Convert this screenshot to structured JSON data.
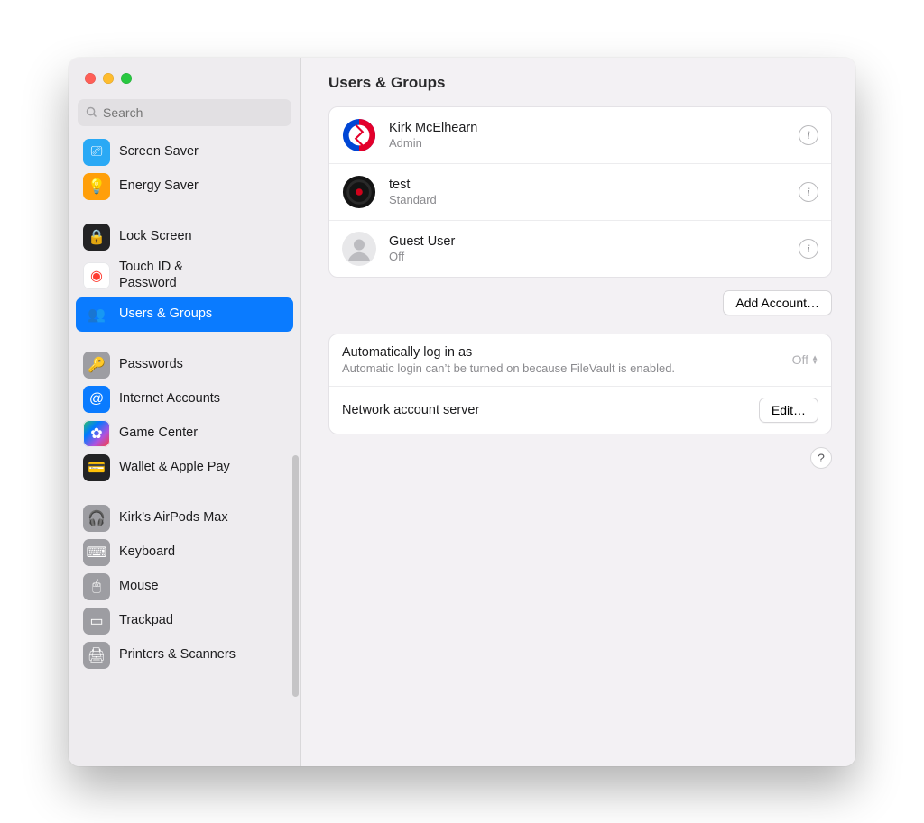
{
  "window": {
    "title": "Users & Groups",
    "search_placeholder": "Search"
  },
  "sidebar": {
    "groups": [
      {
        "items": [
          {
            "id": "screen-saver",
            "label": "Screen Saver",
            "icon_name": "screensaver-icon",
            "icon_bg": "#2aa9f5",
            "glyph": "⎚",
            "selected": false,
            "multiline": false
          },
          {
            "id": "energy-saver",
            "label": "Energy Saver",
            "icon_name": "bulb-icon",
            "icon_bg": "#ff9f0a",
            "glyph": "💡",
            "selected": false,
            "multiline": false
          }
        ]
      },
      {
        "items": [
          {
            "id": "lock-screen",
            "label": "Lock Screen",
            "icon_name": "lock-icon",
            "icon_bg": "#232325",
            "glyph": "🔒",
            "selected": false,
            "multiline": false
          },
          {
            "id": "touchid",
            "label": "Touch ID & Password",
            "icon_name": "touchid-icon",
            "icon_bg": "#ffffff",
            "glyph": "◉",
            "selected": false,
            "multiline": true
          },
          {
            "id": "users-groups",
            "label": "Users & Groups",
            "icon_name": "users-icon",
            "icon_bg": "#0a7bff",
            "glyph": "👥",
            "selected": true,
            "multiline": false
          }
        ]
      },
      {
        "items": [
          {
            "id": "passwords",
            "label": "Passwords",
            "icon_name": "key-icon",
            "icon_bg": "#9d9da2",
            "glyph": "🔑",
            "selected": false,
            "multiline": false
          },
          {
            "id": "internet-acc",
            "label": "Internet Accounts",
            "icon_name": "at-icon",
            "icon_bg": "#0a7bff",
            "glyph": "@",
            "selected": false,
            "multiline": false
          },
          {
            "id": "game-center",
            "label": "Game Center",
            "icon_name": "game-icon",
            "icon_bg": "#ffffff",
            "glyph": "✿",
            "selected": false,
            "multiline": false
          },
          {
            "id": "wallet",
            "label": "Wallet & Apple Pay",
            "icon_name": "wallet-icon",
            "icon_bg": "#232325",
            "glyph": "💳",
            "selected": false,
            "multiline": false
          }
        ]
      },
      {
        "items": [
          {
            "id": "airpods",
            "label": "Kirk’s AirPods Max",
            "icon_name": "headphones-icon",
            "icon_bg": "#9d9da2",
            "glyph": "🎧",
            "selected": false,
            "multiline": false
          },
          {
            "id": "keyboard",
            "label": "Keyboard",
            "icon_name": "keyboard-icon",
            "icon_bg": "#9d9da2",
            "glyph": "⌨",
            "selected": false,
            "multiline": false
          },
          {
            "id": "mouse",
            "label": "Mouse",
            "icon_name": "mouse-icon",
            "icon_bg": "#9d9da2",
            "glyph": "🖱",
            "selected": false,
            "multiline": false
          },
          {
            "id": "trackpad",
            "label": "Trackpad",
            "icon_name": "trackpad-icon",
            "icon_bg": "#9d9da2",
            "glyph": "▭",
            "selected": false,
            "multiline": false
          },
          {
            "id": "printers",
            "label": "Printers & Scanners",
            "icon_name": "printer-icon",
            "icon_bg": "#9d9da2",
            "glyph": "🖨",
            "selected": false,
            "multiline": false
          }
        ]
      }
    ]
  },
  "content": {
    "users": [
      {
        "name": "Kirk McElhearn",
        "role": "Admin",
        "avatar": "gd"
      },
      {
        "name": "test",
        "role": "Standard",
        "avatar": "vinyl"
      },
      {
        "name": "Guest User",
        "role": "Off",
        "avatar": "guest"
      }
    ],
    "add_account_label": "Add Account…",
    "auto_login": {
      "label": "Automatically log in as",
      "value": "Off",
      "detail": "Automatic login can’t be turned on because FileVault is enabled."
    },
    "network_server": {
      "label": "Network account server",
      "button": "Edit…"
    },
    "help_glyph": "?"
  }
}
